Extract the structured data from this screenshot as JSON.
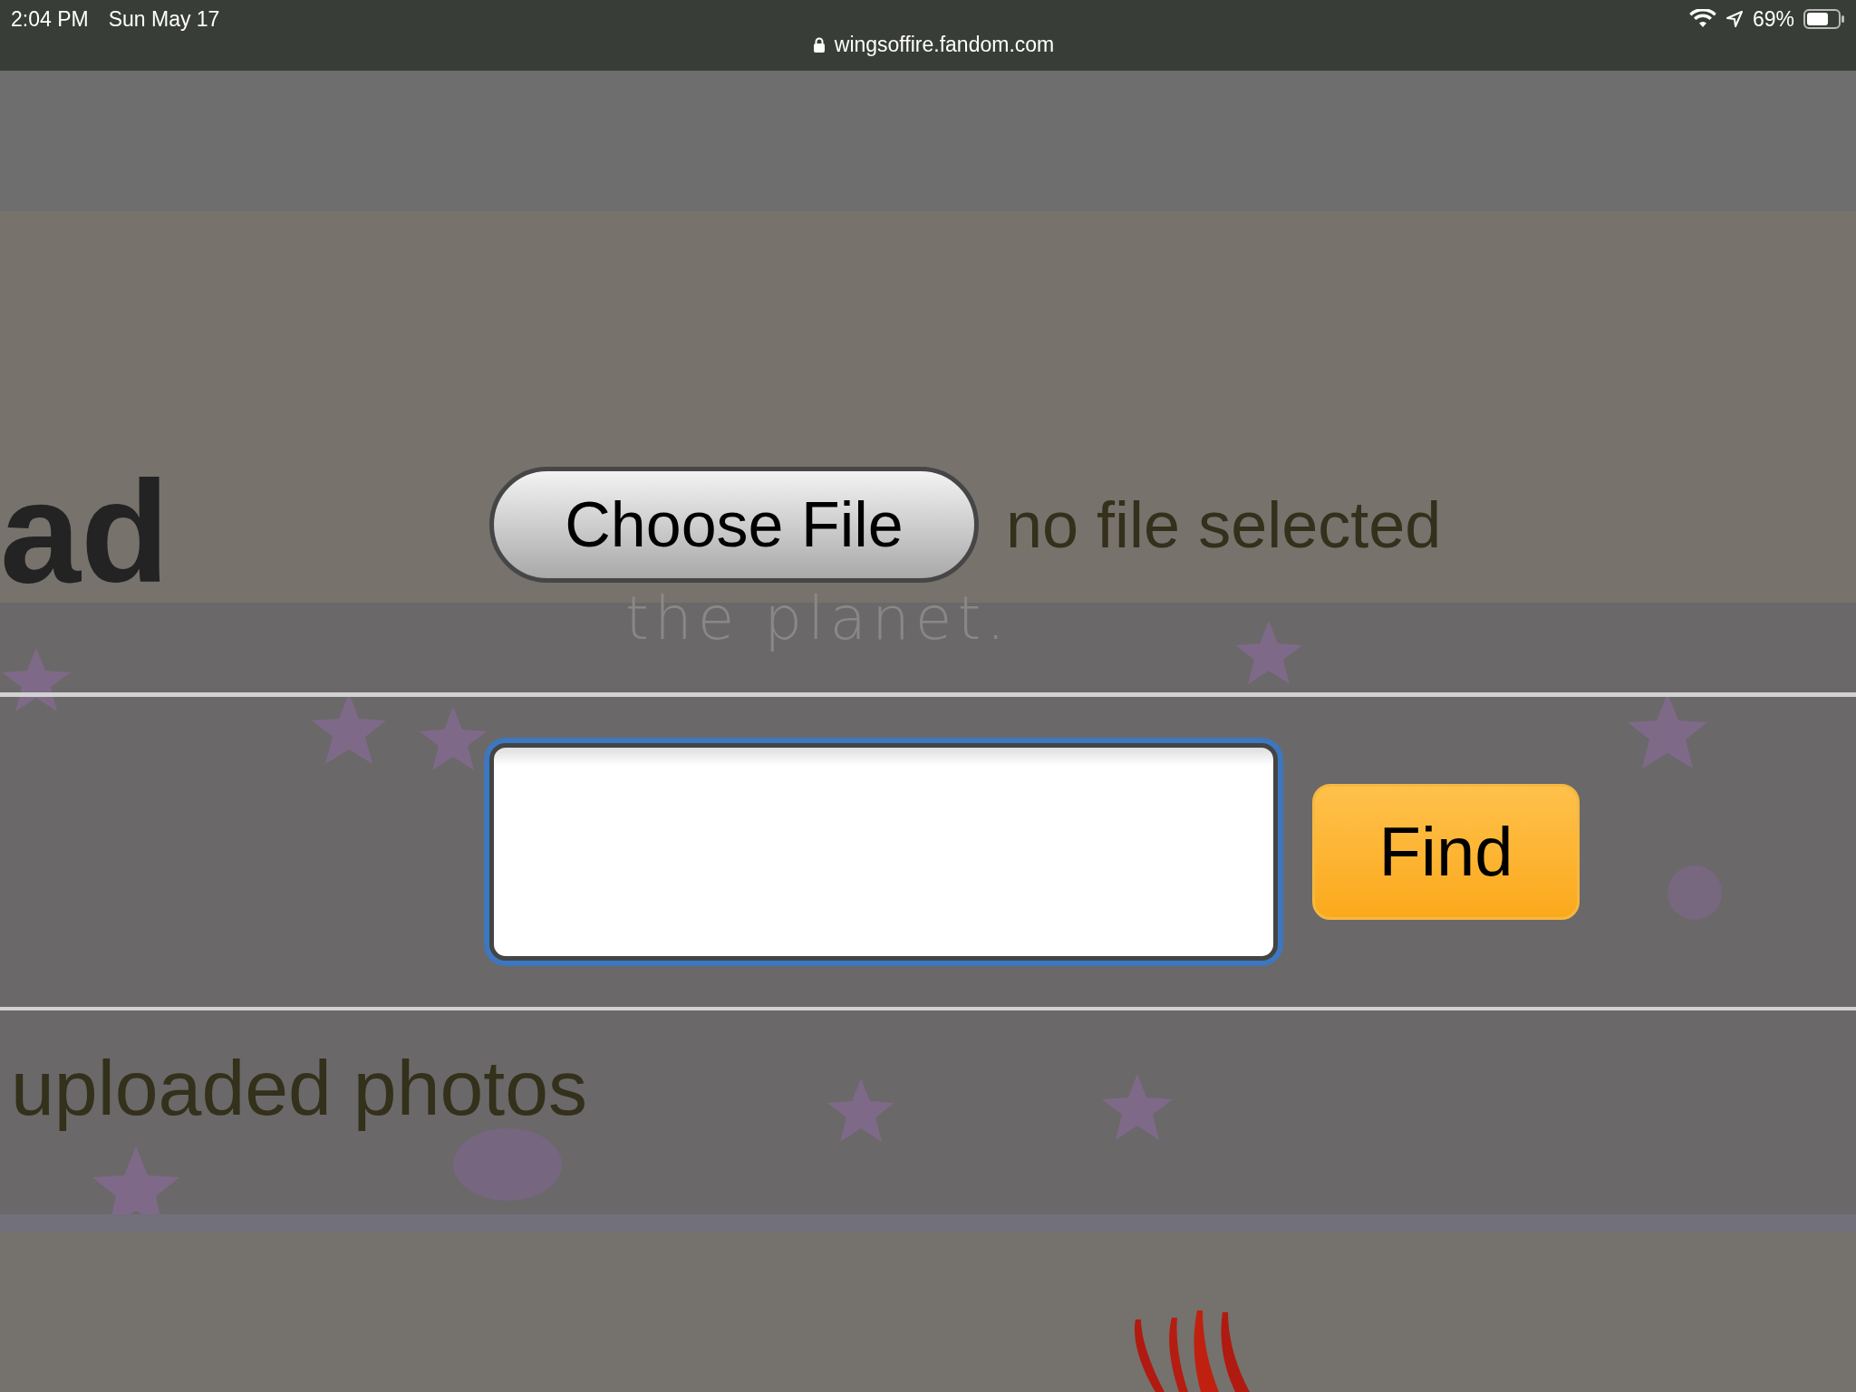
{
  "status_bar": {
    "time": "2:04 PM",
    "date": "Sun May 17",
    "url": "wingsoffire.fandom.com",
    "battery": "69%"
  },
  "page": {
    "heading": "ad",
    "file_picker": {
      "button": "Choose File",
      "status": "no file selected"
    },
    "tagline": "the planet.",
    "search": {
      "focused": true
    },
    "find_button": "Find",
    "section_title": "uploaded photos"
  }
}
